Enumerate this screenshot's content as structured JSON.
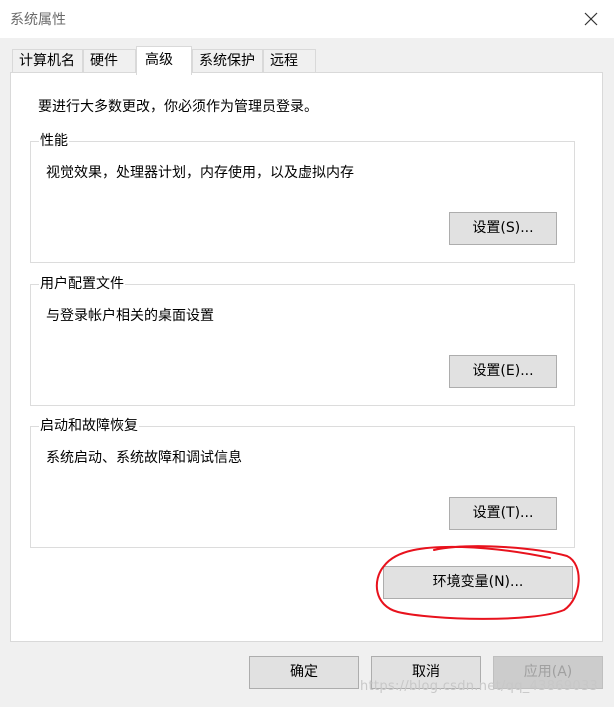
{
  "window": {
    "title": "系统属性",
    "close_icon": "close-icon"
  },
  "tabs": [
    {
      "label": "计算机名"
    },
    {
      "label": "硬件"
    },
    {
      "label": "高级",
      "active": true
    },
    {
      "label": "系统保护"
    },
    {
      "label": "远程"
    }
  ],
  "notice": "要进行大多数更改，你必须作为管理员登录。",
  "groups": {
    "performance": {
      "label": "性能",
      "description": "视觉效果，处理器计划，内存使用，以及虚拟内存",
      "button": "设置(S)..."
    },
    "user_profiles": {
      "label": "用户配置文件",
      "description": "与登录帐户相关的桌面设置",
      "button": "设置(E)..."
    },
    "startup_recovery": {
      "label": "启动和故障恢复",
      "description": "系统启动、系统故障和调试信息",
      "button": "设置(T)..."
    }
  },
  "env_button": "环境变量(N)...",
  "footer": {
    "ok": "确定",
    "cancel": "取消",
    "apply": "应用(A)"
  },
  "annotation": {
    "color": "#e8121d"
  },
  "watermark": "https://blog.csdn.net/qq_43869033"
}
